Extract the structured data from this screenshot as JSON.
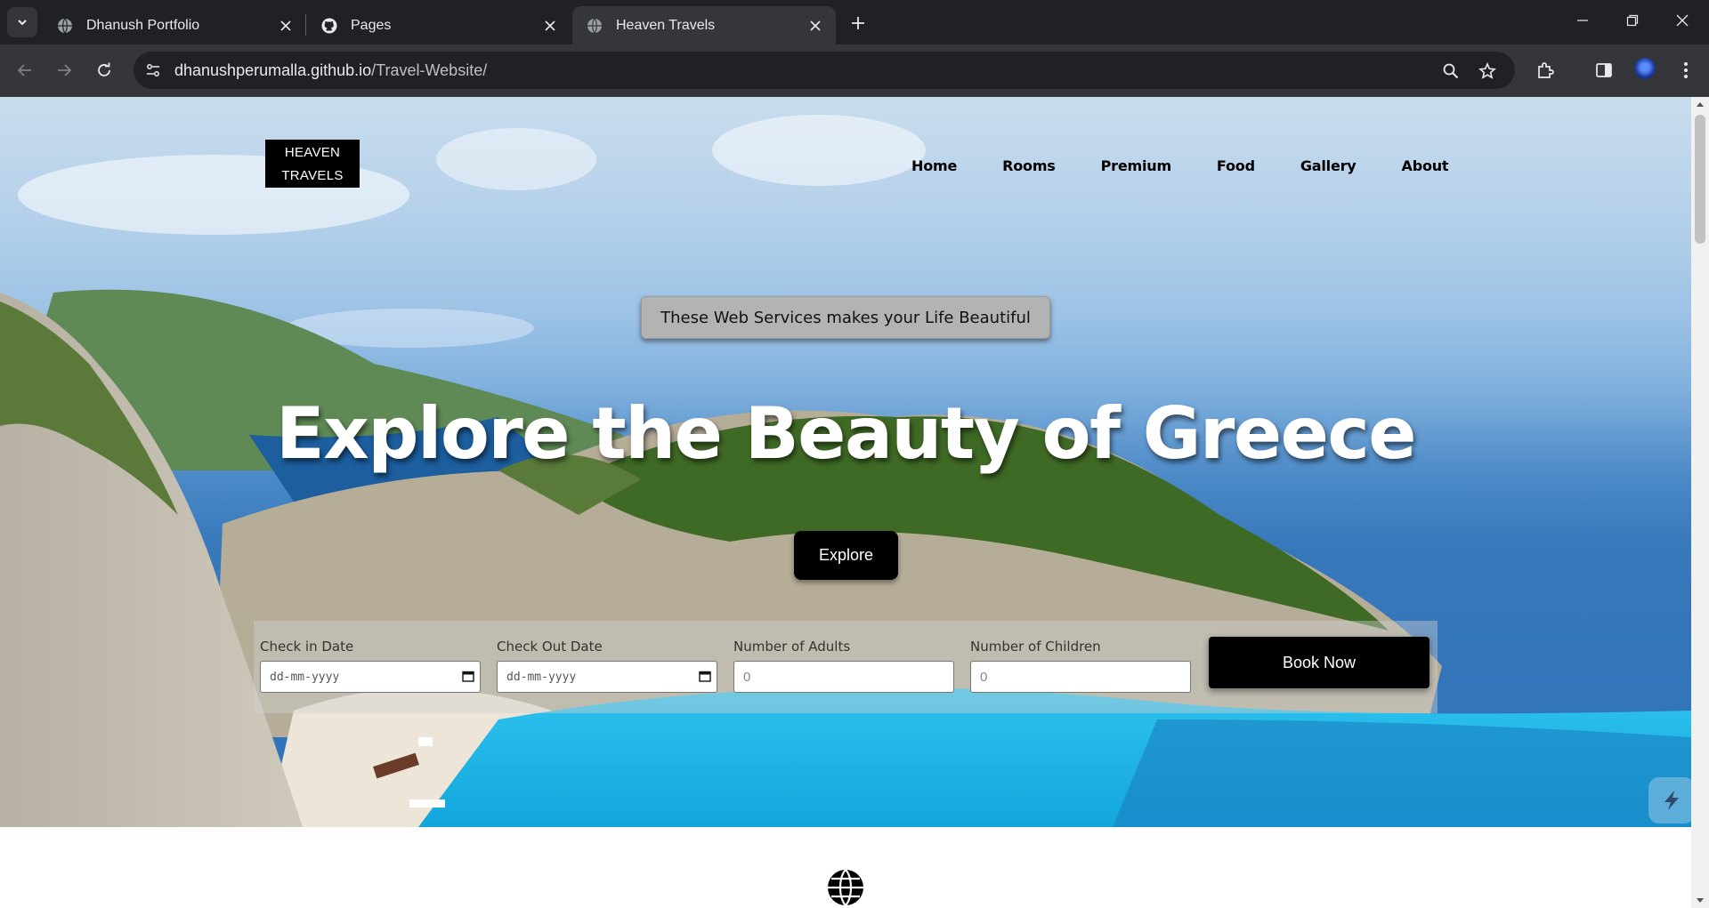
{
  "browser": {
    "tabs": [
      {
        "title": "Dhanush Portfolio",
        "active": false,
        "favicon": "globe-icon"
      },
      {
        "title": "Pages",
        "active": false,
        "favicon": "github-icon"
      },
      {
        "title": "Heaven Travels",
        "active": true,
        "favicon": "globe-icon"
      }
    ],
    "url_host": "dhanushperumalla.github.io",
    "url_path": "/Travel-Website/"
  },
  "site": {
    "logo_line1": "HEAVEN",
    "logo_line2": "TRAVELS",
    "nav": [
      "Home",
      "Rooms",
      "Premium",
      "Food",
      "Gallery",
      "About"
    ],
    "tagline": "These Web Services makes your Life Beautiful",
    "headline": "Explore the Beauty of Greece",
    "explore_label": "Explore",
    "booking": {
      "checkin_label": "Check in Date",
      "checkin_placeholder": "dd-mm-yyyy",
      "checkout_label": "Check Out Date",
      "checkout_placeholder": "dd-mm-yyyy",
      "adults_label": "Number of Adults",
      "adults_value": "0",
      "children_label": "Number of Children",
      "children_value": "0",
      "book_label": "Book Now"
    }
  },
  "colors": {
    "chrome_bg": "#202124",
    "chrome_toolbar": "#35363a",
    "button_bg": "#000000",
    "sea": "#2f72b8",
    "lagoon": "#1fb8e8"
  }
}
